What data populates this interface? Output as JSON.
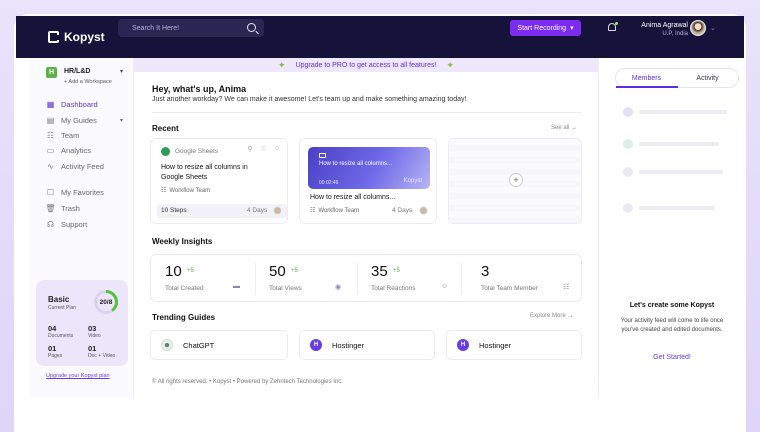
{
  "app": {
    "name": "Kopyst"
  },
  "header": {
    "search_placeholder": "Search It Here!",
    "record_label": "Start Recording",
    "user_name": "Anima Agrawal",
    "user_location": "U.P, India"
  },
  "sidebar": {
    "workspace_badge": "H",
    "workspace_name": "HR/L&D",
    "add_workspace": "+ Add a Workspace",
    "items": [
      {
        "label": "Dashboard",
        "icon": "grid-icon"
      },
      {
        "label": "My Guides",
        "icon": "guide-icon"
      },
      {
        "label": "Team",
        "icon": "team-icon"
      },
      {
        "label": "Analytics",
        "icon": "analytics-icon"
      },
      {
        "label": "Activity Feed",
        "icon": "activity-icon"
      },
      {
        "label": "My Favorites",
        "icon": "favorites-icon"
      },
      {
        "label": "Trash",
        "icon": "trash-icon"
      },
      {
        "label": "Support",
        "icon": "support-icon"
      }
    ],
    "plan": {
      "title": "Basic",
      "subtitle": "Current Plan",
      "usage": "20/8",
      "documents_value": "04",
      "documents_label": "Documents",
      "video_value": "03",
      "video_label": "Video",
      "pages_value": "01",
      "pages_label": "Pages",
      "docvideo_value": "01",
      "docvideo_label": "Doc + Video"
    },
    "upgrade_link": "Upgrade your Kopyst plan"
  },
  "banner": {
    "text": "Upgrade to PRO to get access to all features!"
  },
  "main": {
    "greeting": "Hey, what's up, Anima",
    "greeting_sub": "Just another workday? We can make it awesome! Let's team up and make something amazing today!",
    "recent_title": "Recent",
    "see_all": "See all",
    "cards": [
      {
        "source": "Google Sheets",
        "title": "How to resize all columns in Google Sheets",
        "team": "Workflow Team",
        "steps": "10 Steps",
        "days": "4 Days"
      },
      {
        "video_title": "How to resize all columns...",
        "video_time": "00:02:46",
        "video_brand": "Kopyst",
        "title": "How to resize all columns...",
        "team": "Workflow Team",
        "days": "4 Days"
      }
    ],
    "insights_title": "Weekly Insights",
    "insights": [
      {
        "value": "10",
        "delta": "+5",
        "label": "Total Created",
        "icon": "document-icon"
      },
      {
        "value": "50",
        "delta": "+5",
        "label": "Total Views",
        "icon": "eye-icon"
      },
      {
        "value": "35",
        "delta": "+5",
        "label": "Total Reactions",
        "icon": "reaction-icon"
      },
      {
        "value": "3",
        "delta": "",
        "label": "Total Team Member",
        "icon": "team-icon"
      }
    ],
    "trending_title": "Trending Guides",
    "explore_more": "Explore More",
    "trending": [
      {
        "label": "ChatGPT",
        "icon": "chatgpt-icon",
        "color": "#e6efe9"
      },
      {
        "label": "Hostinger",
        "icon": "hostinger-icon",
        "color": "#673de6"
      },
      {
        "label": "Hostinger",
        "icon": "hostinger-icon",
        "color": "#673de6"
      }
    ],
    "footer": "© All rights reserved. • Kopyst • Powered by Zehntech Technologies Inc."
  },
  "right_panel": {
    "tabs": [
      "Members",
      "Activity"
    ],
    "empty_title": "Let's create some Kopyst",
    "empty_sub": "Your activity feed will come to life once you've created and edited documents.",
    "cta": "Get Started!"
  },
  "colors": {
    "accent": "#5a2ee0",
    "header_bg": "#17123a",
    "record_btn": "#7b2cf0",
    "positive": "#4fb03a"
  }
}
